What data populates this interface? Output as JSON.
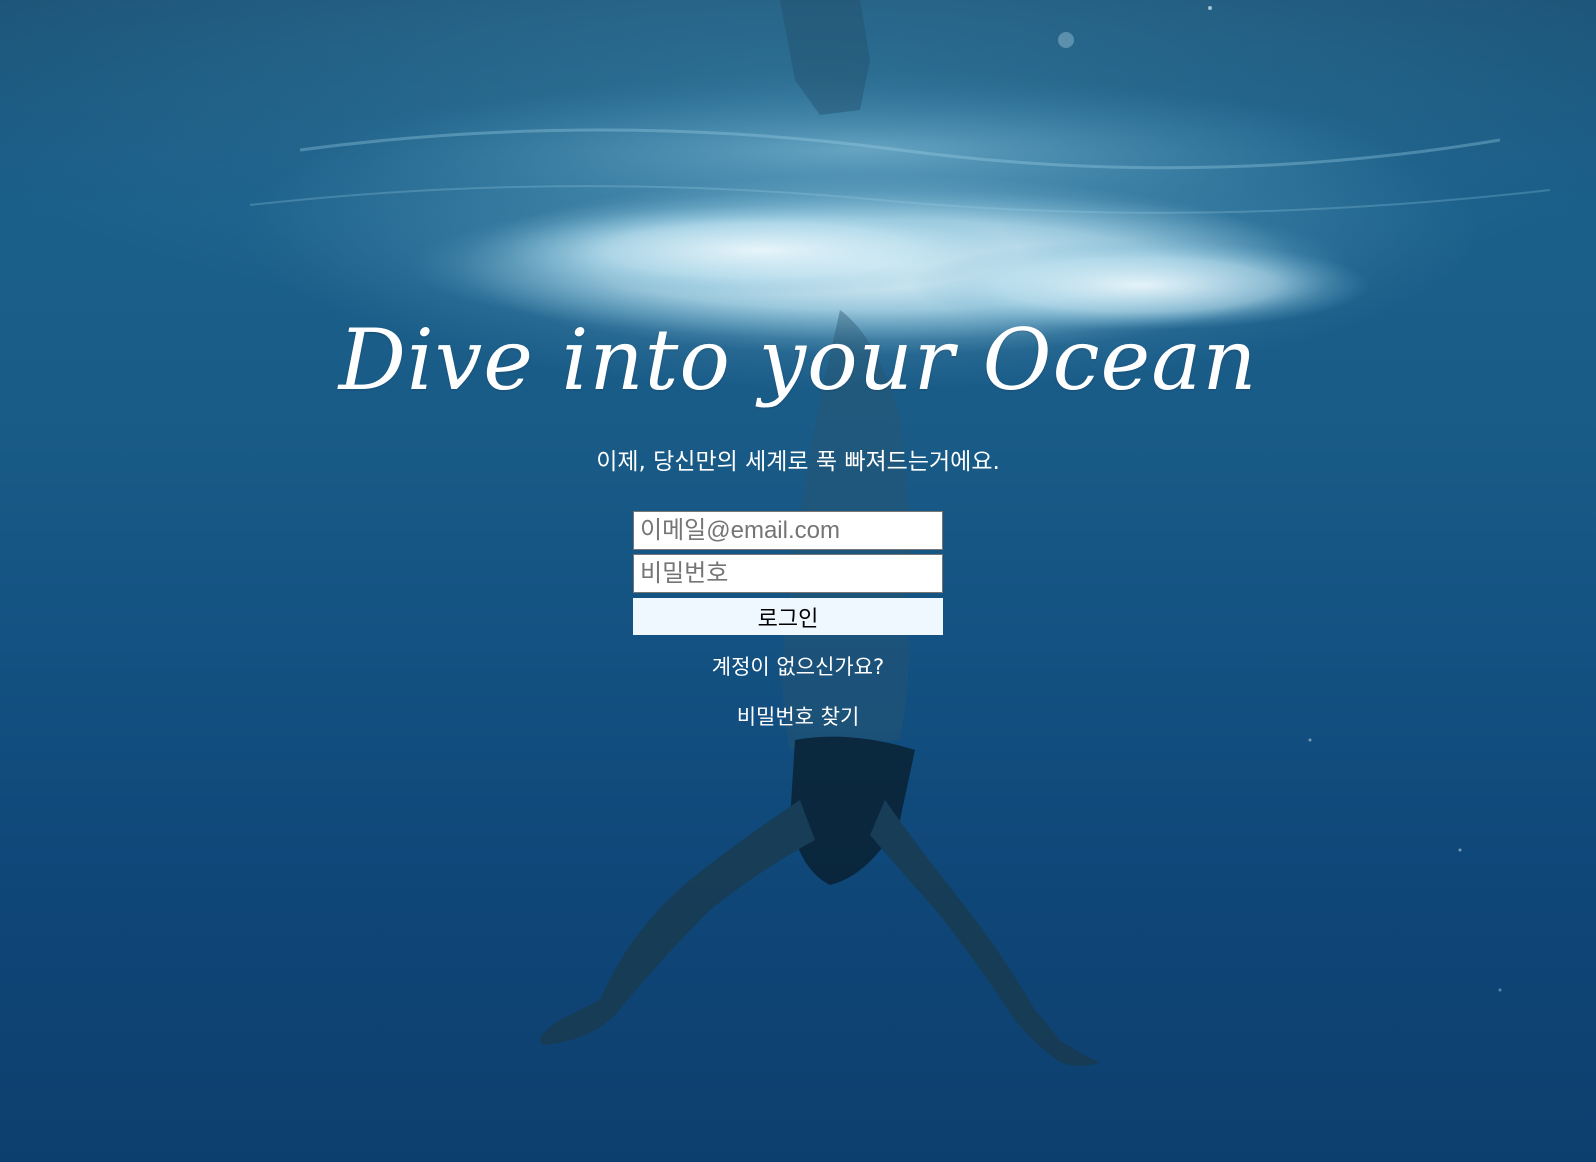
{
  "hero": {
    "title": "Dive into your Ocean",
    "subtitle": "이제, 당신만의 세계로 푹 빠져드는거에요."
  },
  "login_form": {
    "email_placeholder": "이메일@email.com",
    "password_placeholder": "비밀번호",
    "login_label": "로그인"
  },
  "links": {
    "signup": "계정이 없으신가요?",
    "forgot_password": "비밀번호 찾기"
  },
  "colors": {
    "ocean_top": "#1c5478",
    "ocean_bottom": "#0d3f6e",
    "button_bg": "#f0f8ff",
    "text": "#ffffff"
  },
  "background_image": "underwater-diver-photo"
}
